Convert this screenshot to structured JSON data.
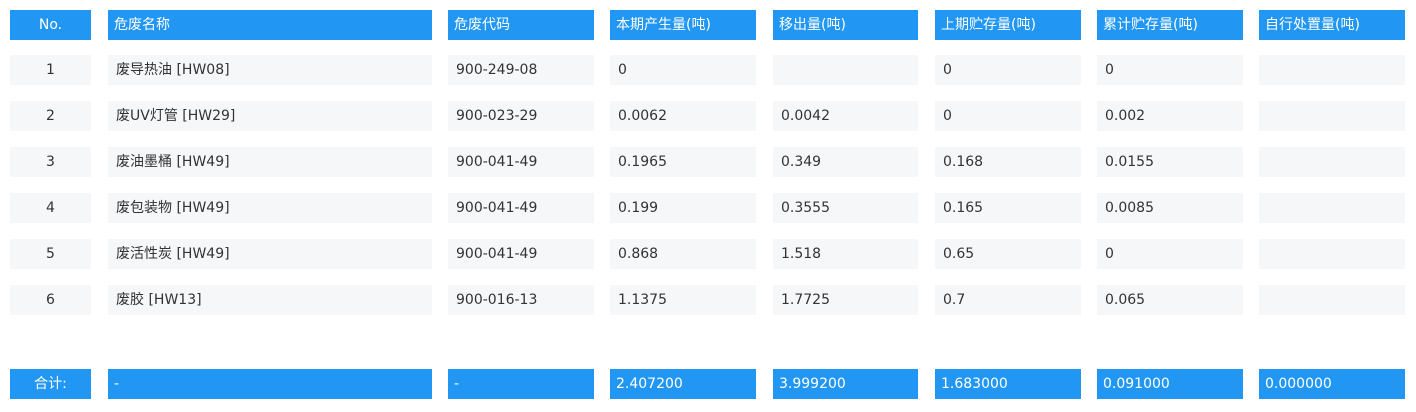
{
  "table": {
    "headers": [
      "No.",
      "危废名称",
      "危废代码",
      "本期产生量(吨)",
      "移出量(吨)",
      "上期贮存量(吨)",
      "累计贮存量(吨)",
      "自行处置量(吨)"
    ],
    "rows": [
      [
        "1",
        "废导热油 [HW08]",
        "900-249-08",
        "0",
        "",
        "0",
        "0",
        ""
      ],
      [
        "2",
        "废UV灯管 [HW29]",
        "900-023-29",
        "0.0062",
        "0.0042",
        "0",
        "0.002",
        ""
      ],
      [
        "3",
        "废油墨桶 [HW49]",
        "900-041-49",
        "0.1965",
        "0.349",
        "0.168",
        "0.0155",
        ""
      ],
      [
        "4",
        "废包装物 [HW49]",
        "900-041-49",
        "0.199",
        "0.3555",
        "0.165",
        "0.0085",
        ""
      ],
      [
        "5",
        "废活性炭 [HW49]",
        "900-041-49",
        "0.868",
        "1.518",
        "0.65",
        "0",
        ""
      ],
      [
        "6",
        "废胶 [HW13]",
        "900-016-13",
        "1.1375",
        "1.7725",
        "0.7",
        "0.065",
        ""
      ]
    ],
    "totals": [
      "合计:",
      "-",
      "-",
      "2.407200",
      "3.999200",
      "1.683000",
      "0.091000",
      "0.000000"
    ]
  }
}
